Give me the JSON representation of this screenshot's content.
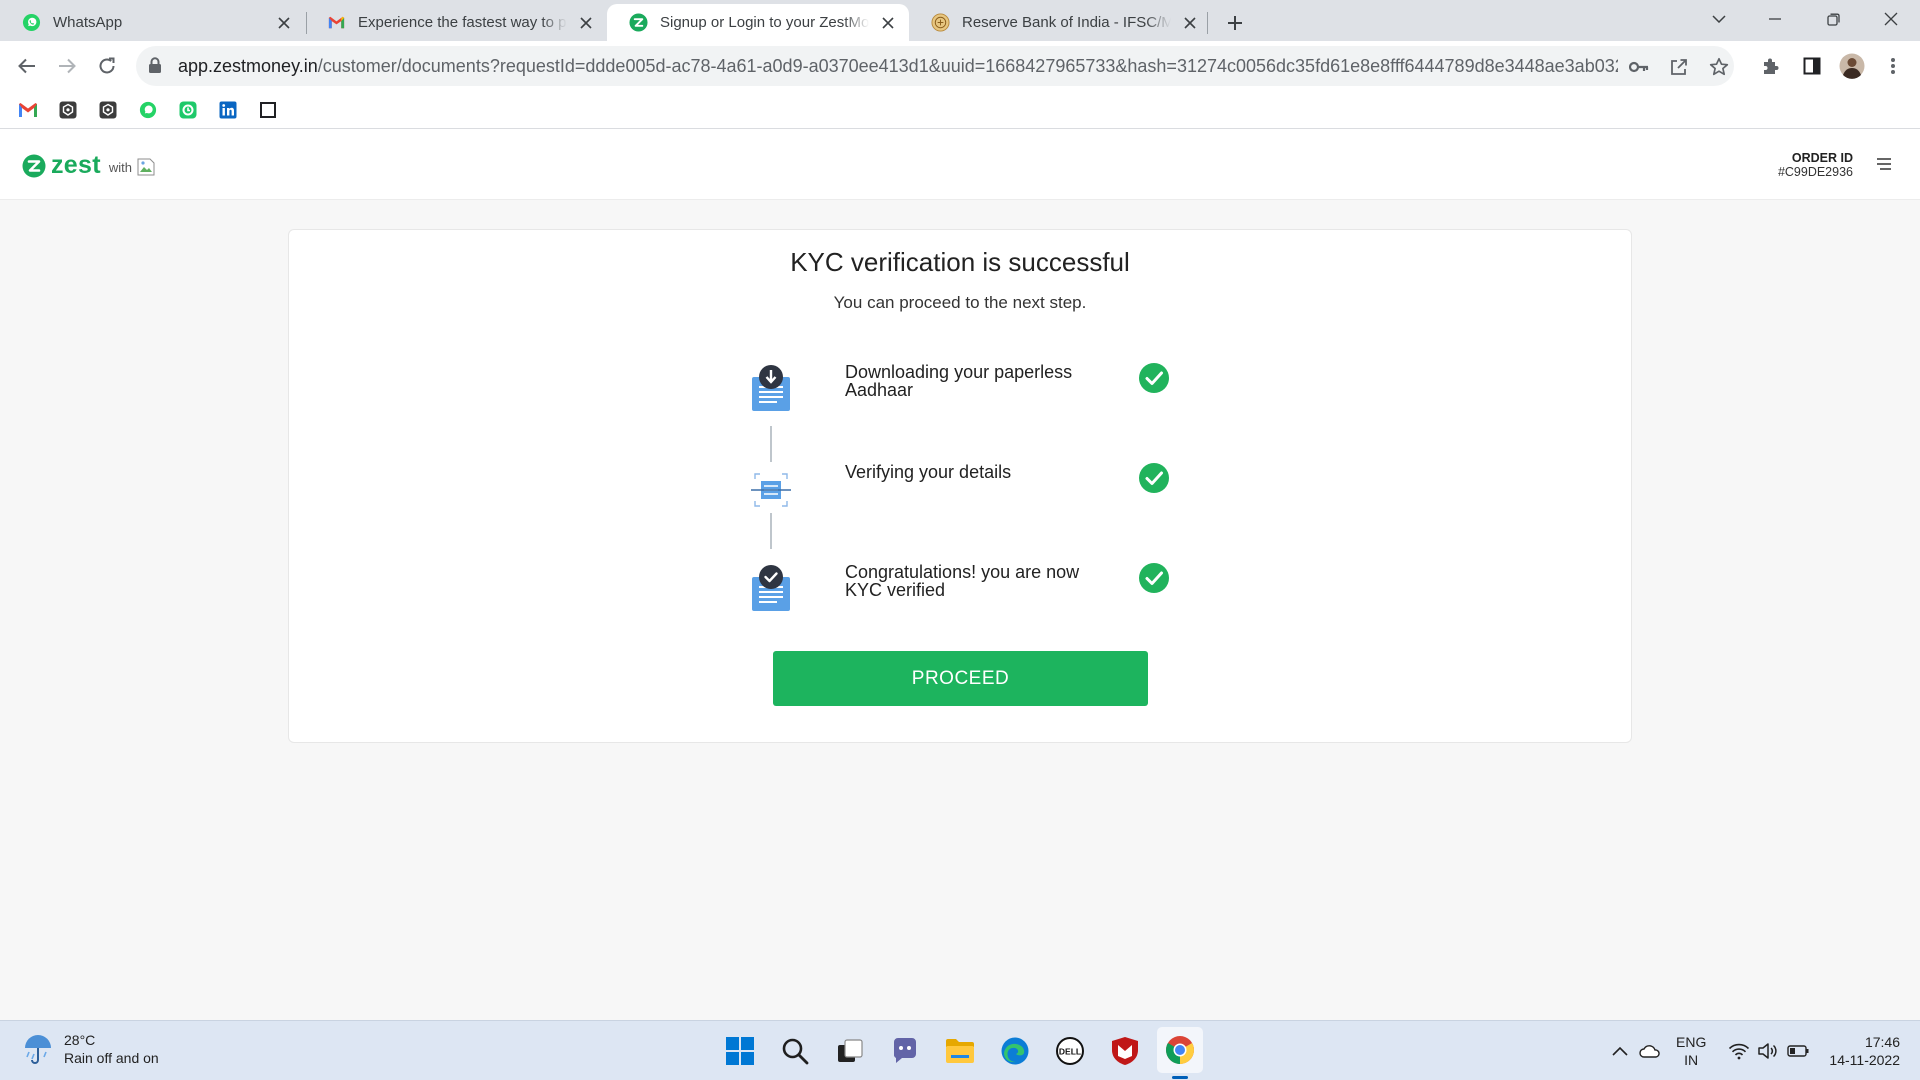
{
  "browser": {
    "tabs": [
      {
        "title": "WhatsApp",
        "favicon": "whatsapp-icon",
        "active": false
      },
      {
        "title": "Experience the fastest way to pay",
        "favicon": "gmail-icon",
        "active": false
      },
      {
        "title": "Signup or Login to your ZestMoney",
        "favicon": "zest-icon",
        "active": true
      },
      {
        "title": "Reserve Bank of India - IFSC/MICR",
        "favicon": "rbi-icon",
        "active": false
      }
    ],
    "url_host": "app.zestmoney.in",
    "url_rest": "/customer/documents?requestId=ddde005d-ac78-4a61-a0d9-a0370ee413d1&uuid=1668427965733&hash=31274c0056dc35fd61e8e8fff6444789d8e3448ae3ab032f9b...",
    "bookmarks": [
      "gmail-icon",
      "extension-icon",
      "extension-icon",
      "whatsapp-icon",
      "app-icon",
      "linkedin-icon",
      "square-icon"
    ]
  },
  "app": {
    "logo_text": "zest",
    "with_text": "with",
    "order_label": "ORDER ID",
    "order_id": "#C99DE2936"
  },
  "kyc": {
    "title": "KYC verification is successful",
    "subtitle": "You can proceed to the next step.",
    "steps": [
      {
        "label": "Downloading your paperless Aadhaar",
        "status": "done"
      },
      {
        "label": "Verifying your details",
        "status": "done"
      },
      {
        "label": "Congratulations! you are now KYC verified",
        "status": "done"
      }
    ],
    "button": "PROCEED"
  },
  "taskbar": {
    "weather_temp": "28°C",
    "weather_desc": "Rain off and on",
    "lang_top": "ENG",
    "lang_bottom": "IN",
    "time": "17:46",
    "date": "14-11-2022"
  },
  "colors": {
    "brand_green": "#1db45e",
    "check_green": "#21b35c",
    "icon_blue": "#4a90d9"
  }
}
